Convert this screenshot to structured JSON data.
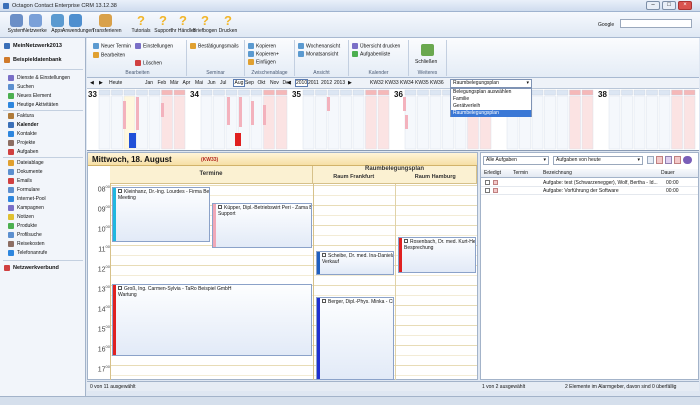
{
  "window": {
    "title": "Octagon Contact Enterprise CRM 13.12.38"
  },
  "toolbar": {
    "items": [
      {
        "label": "System",
        "icon": "system-icon",
        "color": "#6b8fc7"
      },
      {
        "label": "Netzwerke",
        "icon": "network-icon",
        "color": "#7aa0d8"
      },
      {
        "label": "Apps",
        "icon": "apps-icon",
        "color": "#5b9ad0"
      },
      {
        "label": "Anwendungen",
        "icon": "applications-icon",
        "color": "#4f8fcf"
      },
      {
        "label": "Transferieren",
        "icon": "transfer-icon",
        "color": "#d9a14a"
      },
      {
        "label": "Tutorials",
        "icon": "help-icon",
        "color": "#f2b62b"
      },
      {
        "label": "Support",
        "icon": "help-icon",
        "color": "#f2b62b"
      },
      {
        "label": "Ihr Händler",
        "icon": "help-icon",
        "color": "#f2b62b"
      },
      {
        "label": "Briefbogen",
        "icon": "help-icon",
        "color": "#f2b62b"
      },
      {
        "label": "Drucken",
        "icon": "help-icon",
        "color": "#f2b62b"
      }
    ],
    "google_label": "Google",
    "google_value": ""
  },
  "sidebar": {
    "groups": [
      {
        "title": "MeinNetzwerk2013",
        "color": "#3a6fb8"
      },
      {
        "title": "Beispieldatenbank",
        "color": "#d07a2a"
      }
    ],
    "items": [
      {
        "label": "Dienste & Einstellungen",
        "color": "#7a6fc7"
      },
      {
        "label": "Suchen",
        "color": "#5c8fcf"
      },
      {
        "label": "Neues Element",
        "color": "#4caf50"
      },
      {
        "label": "Heutige Aktivitäten",
        "color": "#2e86de"
      },
      {
        "label": "Faktura",
        "color": "#b07b3a"
      },
      {
        "label": "Kalender",
        "color": "#3a6fb8"
      },
      {
        "label": "Kontakte",
        "color": "#2e86de"
      },
      {
        "label": "Projekte",
        "color": "#8d6e63"
      },
      {
        "label": "Aufgaben",
        "color": "#d04040"
      },
      {
        "label": "Dateiablage",
        "color": "#e0a030"
      },
      {
        "label": "Dokumente",
        "color": "#5c8fcf"
      },
      {
        "label": "Emails",
        "color": "#d04040"
      },
      {
        "label": "Formulare",
        "color": "#5c8fcf"
      },
      {
        "label": "Internet-Pool",
        "color": "#2e86de"
      },
      {
        "label": "Kampagnen",
        "color": "#7a6fc7"
      },
      {
        "label": "Notizen",
        "color": "#e0c030"
      },
      {
        "label": "Produkte",
        "color": "#4caf50"
      },
      {
        "label": "Profilsuche",
        "color": "#5c8fcf"
      },
      {
        "label": "Reisekosten",
        "color": "#8d6e63"
      },
      {
        "label": "Telefonanrufe",
        "color": "#2e86de"
      },
      {
        "label": "Netzwerkverbund",
        "color": "#d04040"
      }
    ]
  },
  "ribbon": {
    "groups": [
      {
        "caption": "Bearbeiten",
        "buttons": [
          "Neuer Termin",
          "Bearbeiten",
          "Einstellungen",
          "Löschen"
        ]
      },
      {
        "caption": "Seminar",
        "buttons": [
          "Bestätigungsmails"
        ]
      },
      {
        "caption": "Zwischenablage",
        "buttons": [
          "Kopieren",
          "Kopieren+",
          "Einfügen"
        ]
      },
      {
        "caption": "Ansicht",
        "buttons": [
          "Wochenansicht",
          "Monatsansicht"
        ]
      },
      {
        "caption": "Kalender",
        "buttons": [
          "Übersicht drucken",
          "Aufgabenliste"
        ]
      },
      {
        "caption": "Weiteres",
        "buttons": [
          "Schließen"
        ]
      }
    ]
  },
  "nav": {
    "today": "Heute",
    "months": [
      "Jan",
      "Feb",
      "Mär",
      "Apr",
      "Mai",
      "Jun",
      "Jul",
      "Aug",
      "Sep",
      "Okt",
      "Nov",
      "Dez"
    ],
    "active_month": "Aug",
    "years": [
      "2010",
      "2011",
      "2012",
      "2013"
    ],
    "active_year": "2010",
    "kw": [
      "KW32",
      "KW33",
      "KW34",
      "KW35",
      "KW36"
    ],
    "plan_select": "Raumbelegungsplan",
    "plan_options": [
      "Belegungsplan auswählen",
      "Familie",
      "Gerätverleih",
      "Raumbelegungsplan"
    ]
  },
  "weeks": [
    {
      "no": "33"
    },
    {
      "no": "34"
    },
    {
      "no": "35"
    },
    {
      "no": "36"
    },
    {
      "no": "37"
    },
    {
      "no": "38"
    }
  ],
  "calendar": {
    "date": "Mittwoch, 18. August",
    "kw": "(KW33)",
    "columns": [
      {
        "title": "Termine"
      }
    ],
    "plan": {
      "title": "Raumbelegungsplan",
      "rooms": [
        "Raum Frankfurt",
        "Raum Hamburg"
      ]
    },
    "hours": [
      "08",
      "09",
      "10",
      "11",
      "12",
      "13",
      "14",
      "15",
      "16",
      "17"
    ],
    "appointments": [
      {
        "title": "Kleinhanz, Dr.-Ing. Lourdes - Firma Beispiel ...",
        "sub": "Meeting",
        "color": "#20b8e0"
      },
      {
        "title": "Küpper, Dipl.-Betriebswirt Peri - Zama Beispi...",
        "sub": "Support",
        "color": "#f0a8b8"
      },
      {
        "title": "Groß, Ing. Carmen-Sylvia - TaRo Beispiel GmbH",
        "sub": "Wartung",
        "color": "#e02020"
      },
      {
        "title": "Scheibe, Dr. med. Ina-Daniela - LR...",
        "sub": "Verkauf",
        "color": "#2060c0"
      },
      {
        "title": "Rosenbach, Dr. med. Kurt-Hermann",
        "sub": "Besprechung",
        "color": "#e02020"
      },
      {
        "title": "Berger, Dipl.-Phys. Minka - Cito Beisp...",
        "sub": "",
        "color": "#2030d0"
      }
    ]
  },
  "tasks": {
    "filter1": "Alle Aufgaben",
    "filter2": "Aufgaben von heute",
    "headers": [
      "Erledigt",
      "Termin",
      "Bezeichnung",
      "Dauer"
    ],
    "rows": [
      {
        "title": "Aufgabe: test (Schwarzenegger), Wolf, Bertha - Id...",
        "dur": "00:00"
      },
      {
        "title": "Aufgabe: Vorführung der Software",
        "dur": "00:00"
      }
    ]
  },
  "status": {
    "left": "0 von 11 ausgewählt",
    "mid": "1 von 2 ausgewählt",
    "right": "2 Elemente im Alarmgeber, davon sind 0 überfällig"
  }
}
